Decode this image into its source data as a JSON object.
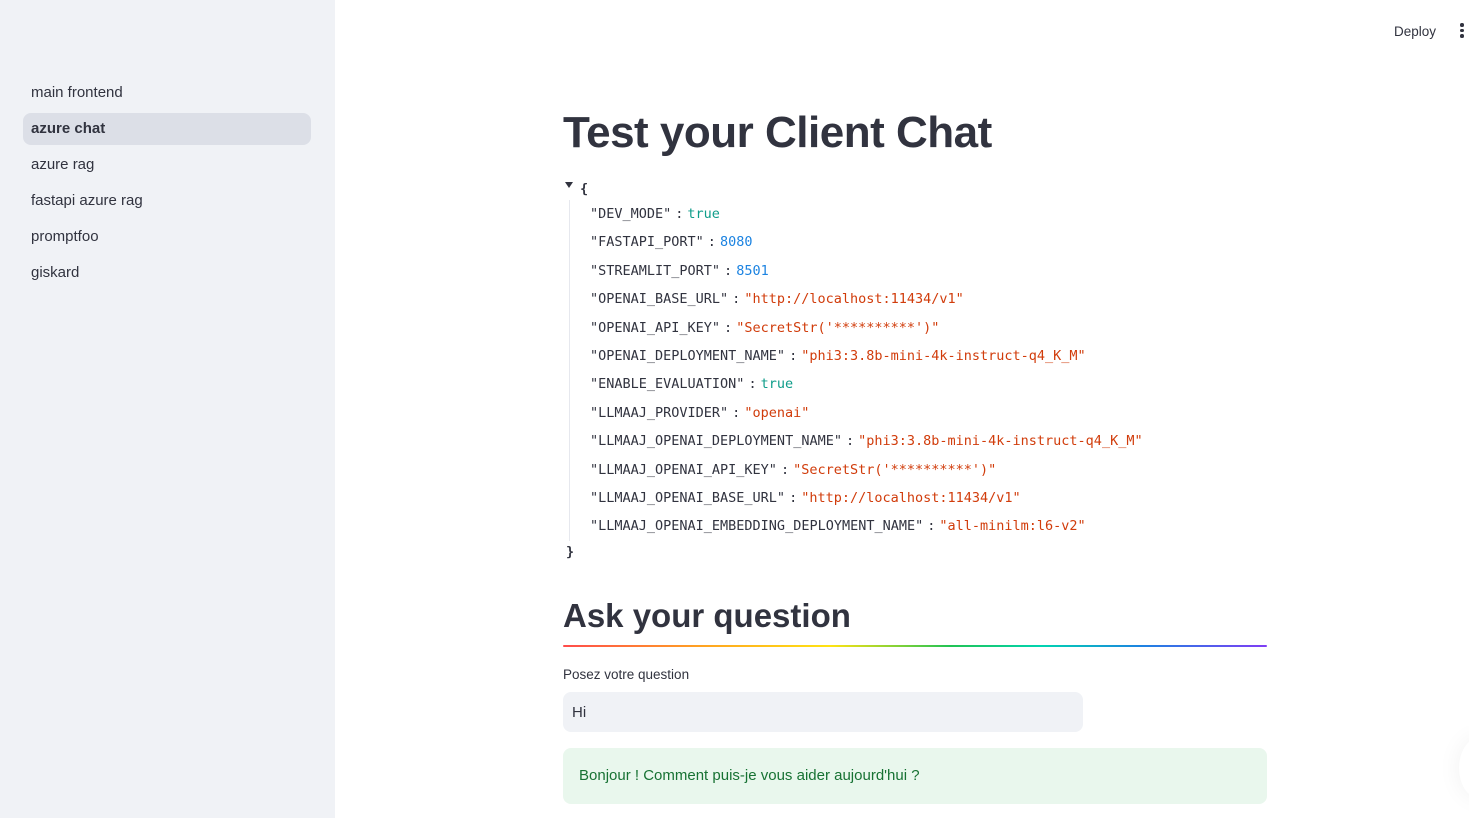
{
  "sidebar": {
    "items": [
      {
        "label": "main frontend",
        "active": false
      },
      {
        "label": "azure chat",
        "active": true
      },
      {
        "label": "azure rag",
        "active": false
      },
      {
        "label": "fastapi azure rag",
        "active": false
      },
      {
        "label": "promptfoo",
        "active": false
      },
      {
        "label": "giskard",
        "active": false
      }
    ]
  },
  "header": {
    "deploy_label": "Deploy",
    "menu_icon": "vertical-dots-icon"
  },
  "main": {
    "title": "Test your Client Chat",
    "json": {
      "open_brace": "{",
      "close_brace": "}",
      "rows": [
        {
          "key": "\"DEV_MODE\"",
          "value": "true",
          "type": "bool"
        },
        {
          "key": "\"FASTAPI_PORT\"",
          "value": "8080",
          "type": "num"
        },
        {
          "key": "\"STREAMLIT_PORT\"",
          "value": "8501",
          "type": "num"
        },
        {
          "key": "\"OPENAI_BASE_URL\"",
          "value": "\"http://localhost:11434/v1\"",
          "type": "str"
        },
        {
          "key": "\"OPENAI_API_KEY\"",
          "value": "\"SecretStr('**********')\"",
          "type": "str"
        },
        {
          "key": "\"OPENAI_DEPLOYMENT_NAME\"",
          "value": "\"phi3:3.8b-mini-4k-instruct-q4_K_M\"",
          "type": "str"
        },
        {
          "key": "\"ENABLE_EVALUATION\"",
          "value": "true",
          "type": "bool"
        },
        {
          "key": "\"LLMAAJ_PROVIDER\"",
          "value": "\"openai\"",
          "type": "str"
        },
        {
          "key": "\"LLMAAJ_OPENAI_DEPLOYMENT_NAME\"",
          "value": "\"phi3:3.8b-mini-4k-instruct-q4_K_M\"",
          "type": "str"
        },
        {
          "key": "\"LLMAAJ_OPENAI_API_KEY\"",
          "value": "\"SecretStr('**********')\"",
          "type": "str"
        },
        {
          "key": "\"LLMAAJ_OPENAI_BASE_URL\"",
          "value": "\"http://localhost:11434/v1\"",
          "type": "str"
        },
        {
          "key": "\"LLMAAJ_OPENAI_EMBEDDING_DEPLOYMENT_NAME\"",
          "value": "\"all-minilm:l6-v2\"",
          "type": "str"
        }
      ]
    },
    "subheader": "Ask your question",
    "input": {
      "label": "Posez votre question",
      "value": "Hi"
    },
    "response": "Bonjour ! Comment puis-je vous aider aujourd'hui ?"
  },
  "colors": {
    "sidebar_bg": "#f0f2f6",
    "active_item_bg": "#dcdfe7",
    "bool": "#0f9d8a",
    "number": "#1c83e1",
    "string": "#d13c0b",
    "success_bg": "#e9f7ed",
    "success_text": "#177233"
  }
}
